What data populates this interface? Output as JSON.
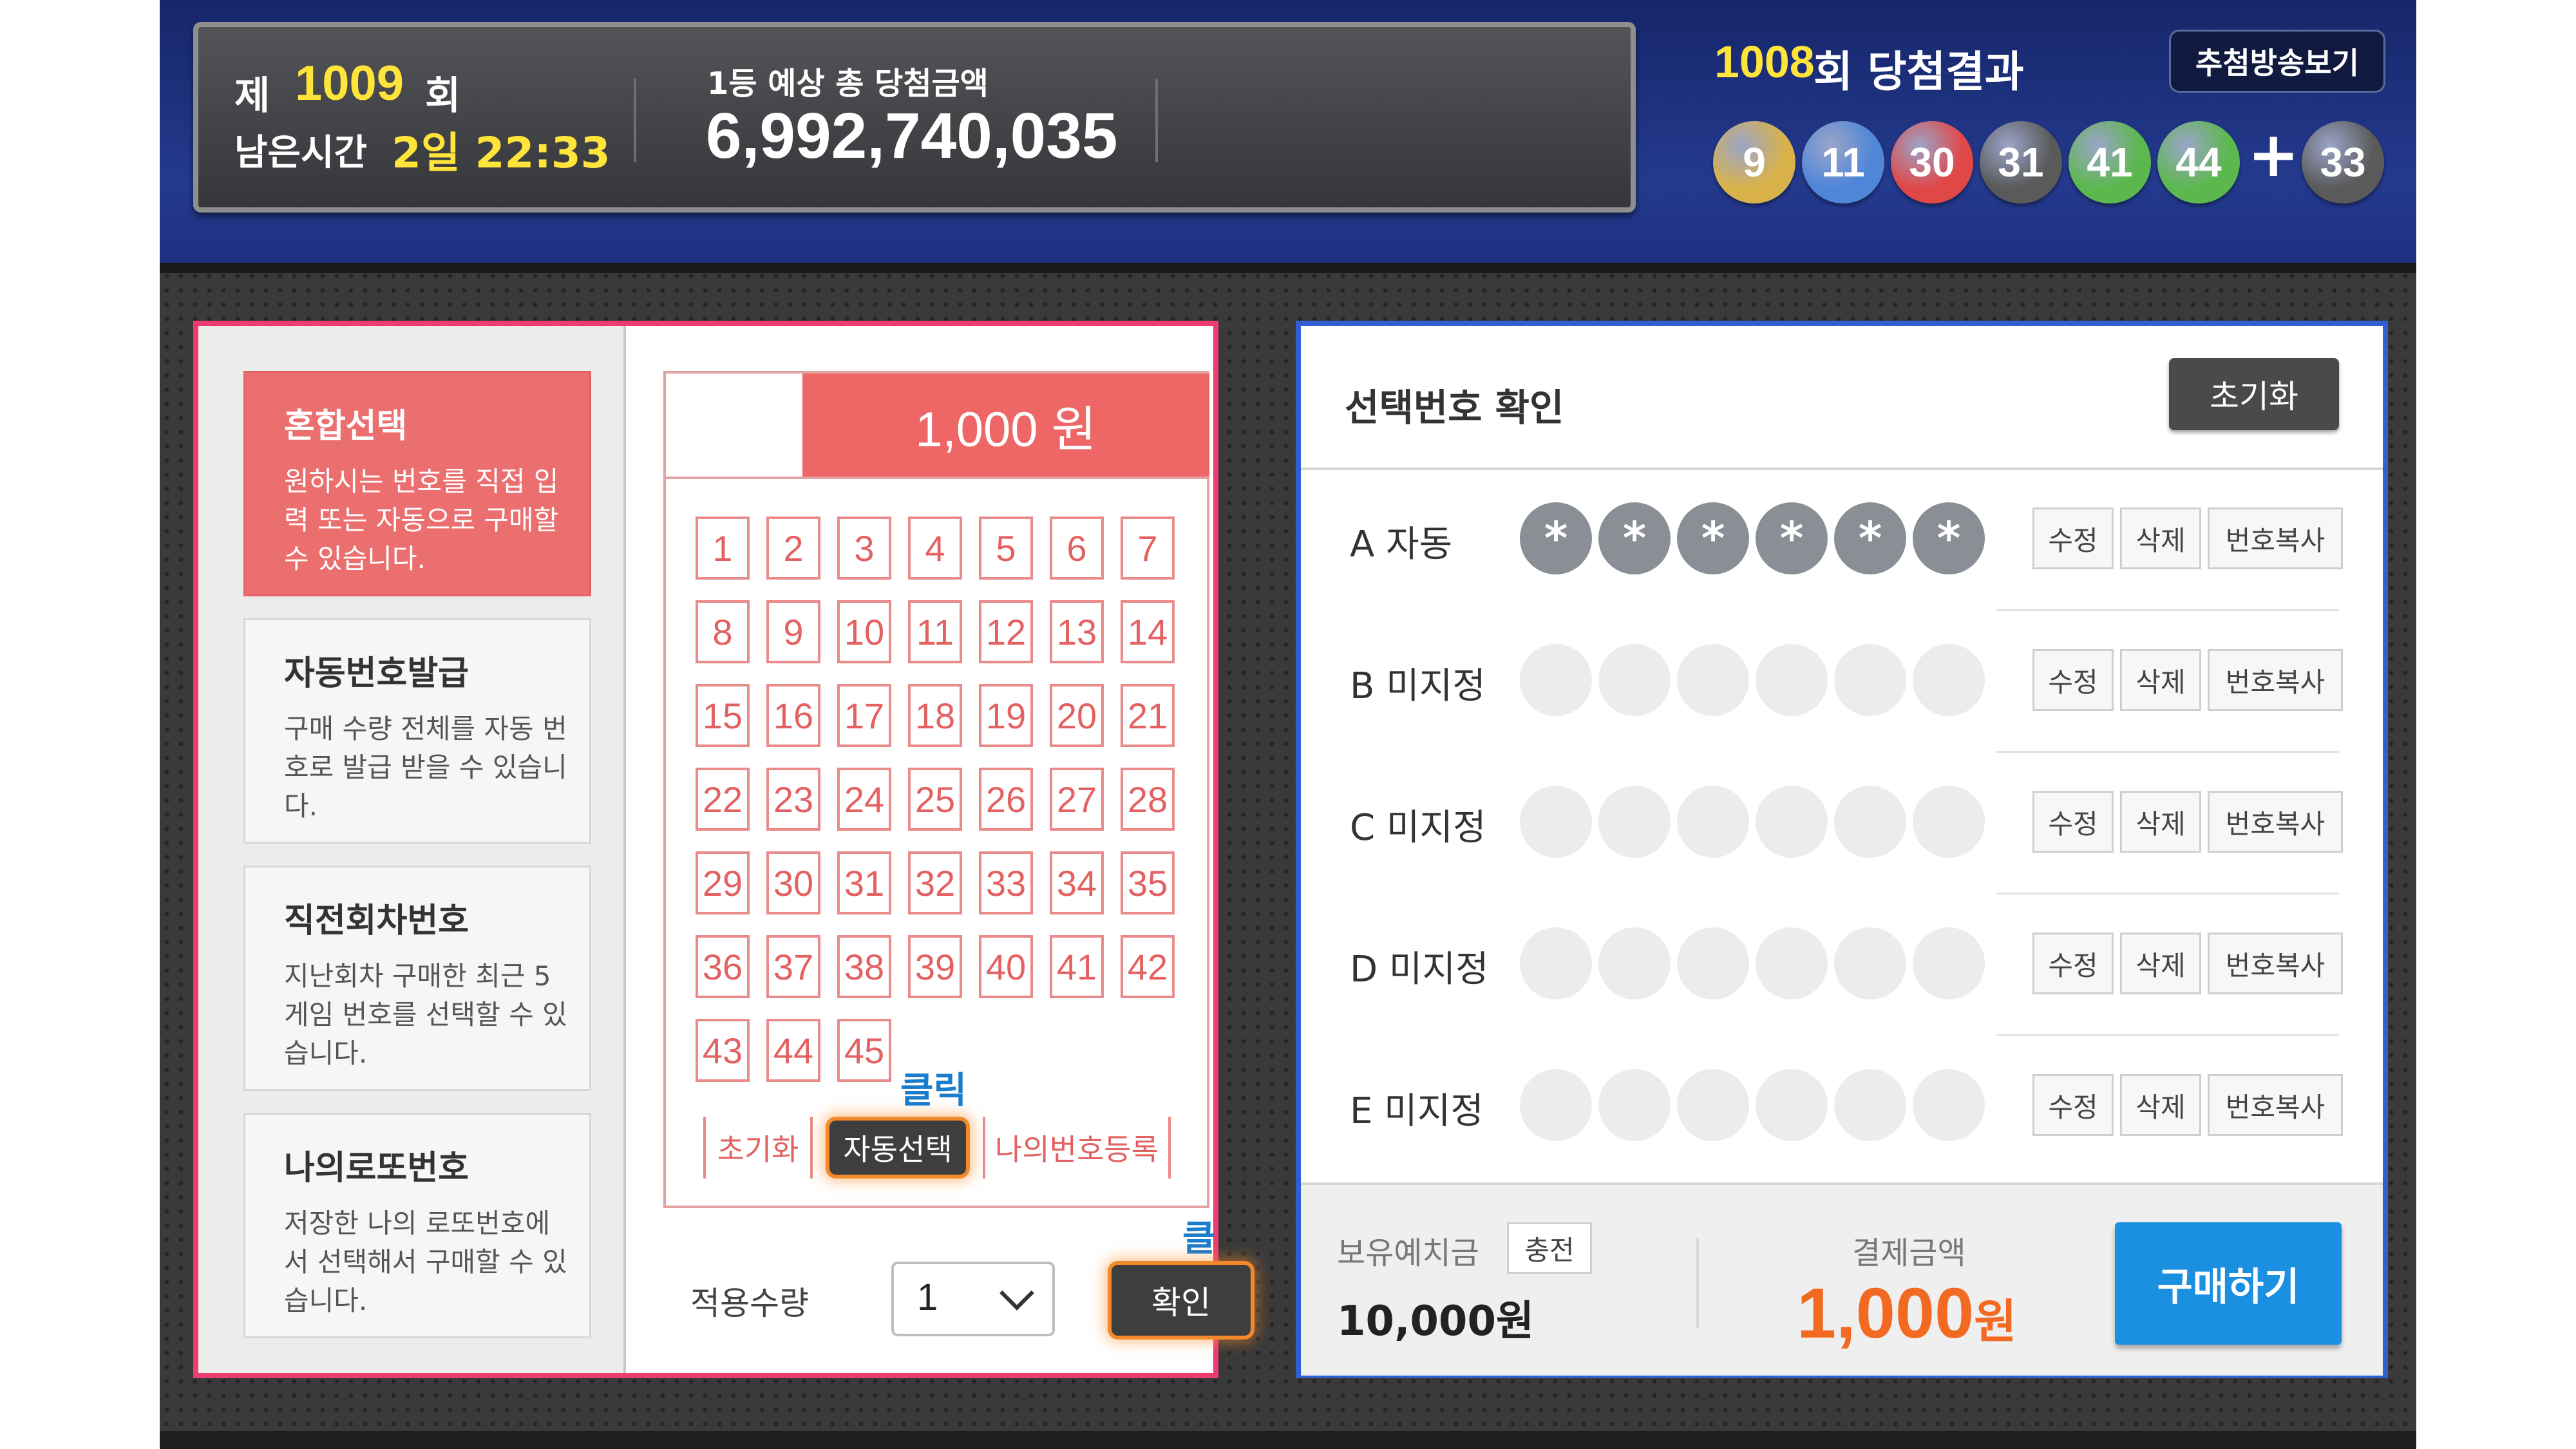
{
  "header": {
    "round_prefix": "제",
    "round_number": "1009",
    "round_suffix": "회",
    "time_label": "남은시간",
    "time_value": "2일 22:33",
    "prize_label": "1등 예상 총 당첨금액",
    "prize_value": "6,992,740,035",
    "result_round": "1008",
    "result_label": "회 당첨결과",
    "broadcast_button": "추첨방송보기",
    "balls": [
      {
        "n": "9",
        "color": "#d9b24a"
      },
      {
        "n": "11",
        "color": "#4f86d8"
      },
      {
        "n": "30",
        "color": "#e04848"
      },
      {
        "n": "31",
        "color": "#5a5a5a"
      },
      {
        "n": "41",
        "color": "#5cb84e"
      },
      {
        "n": "44",
        "color": "#5cb84e"
      }
    ],
    "bonus_ball": {
      "n": "33",
      "color": "#5a5a5a"
    },
    "plus": "+"
  },
  "menu": [
    {
      "title": "혼합선택",
      "desc": "원하시는 번호를 직접 입력 또는 자동으로 구매할 수 있습니다.",
      "active": true
    },
    {
      "title": "자동번호발급",
      "desc": "구매 수량 전체를 자동 번호로 발급 받을 수 있습니다.",
      "active": false
    },
    {
      "title": "직전회차번호",
      "desc": "지난회차 구매한 최근 5게임 번호를 선택할 수 있습니다.",
      "active": false
    },
    {
      "title": "나의로또번호",
      "desc": "저장한 나의 로또번호에서 선택해서 구매할 수 있습니다.",
      "active": false
    }
  ],
  "slip": {
    "price": "1,000 원",
    "numbers": [
      "1",
      "2",
      "3",
      "4",
      "5",
      "6",
      "7",
      "8",
      "9",
      "10",
      "11",
      "12",
      "13",
      "14",
      "15",
      "16",
      "17",
      "18",
      "19",
      "20",
      "21",
      "22",
      "23",
      "24",
      "25",
      "26",
      "27",
      "28",
      "29",
      "30",
      "31",
      "32",
      "33",
      "34",
      "35",
      "36",
      "37",
      "38",
      "39",
      "40",
      "41",
      "42",
      "43",
      "44",
      "45"
    ],
    "reset": "초기화",
    "auto_select": "자동선택",
    "my_numbers": "나의번호등록",
    "click_hint_1": "클릭",
    "click_hint_2": "클릭",
    "qty_label": "적용수량",
    "qty_value": "1",
    "confirm": "확인"
  },
  "confirm_panel": {
    "title": "선택번호 확인",
    "reset": "초기화",
    "rows": [
      {
        "label": "A 자동",
        "filled": true
      },
      {
        "label": "B 미지정",
        "filled": false
      },
      {
        "label": "C 미지정",
        "filled": false
      },
      {
        "label": "D 미지정",
        "filled": false
      },
      {
        "label": "E 미지정",
        "filled": false
      }
    ],
    "star": "*",
    "edit": "수정",
    "delete": "삭제",
    "copy": "번호복사",
    "deposit_label": "보유예치금",
    "charge": "충전",
    "deposit_value": "10,000원",
    "pay_label": "결제금액",
    "pay_amount": "1,000",
    "pay_unit": "원",
    "buy": "구매하기"
  },
  "colors": {
    "accent_red": "#ee3c6e",
    "accent_blue": "#2f5fd3",
    "pay_orange": "#f26a22",
    "buy_blue": "#1b8fe0",
    "highlight_orange": "#f28a2c"
  }
}
